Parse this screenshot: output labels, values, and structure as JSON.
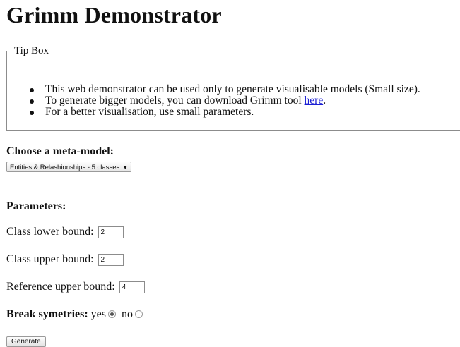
{
  "page": {
    "title": "Grimm Demonstrator"
  },
  "tip_box": {
    "legend": "Tip Box",
    "items": [
      "This web demonstrator can be used only to generate visualisable models (Small size).",
      "To generate bigger models, you can download Grimm tool ",
      "For a better visualisation, use small parameters."
    ],
    "link_text": "here",
    "link_suffix": "."
  },
  "meta_model": {
    "label": "Choose a meta-model:",
    "selected": "Entities & Relashionships - 5 classes"
  },
  "parameters": {
    "heading": "Parameters:",
    "class_lower_label": "Class lower bound:",
    "class_lower_value": "2",
    "class_upper_label": "Class upper bound:",
    "class_upper_value": "2",
    "reference_upper_label": "Reference upper bound:",
    "reference_upper_value": "4"
  },
  "symmetry": {
    "label": "Break symetries:",
    "yes_label": "yes",
    "no_label": "no",
    "selected": "yes"
  },
  "generate_button": "Generate"
}
